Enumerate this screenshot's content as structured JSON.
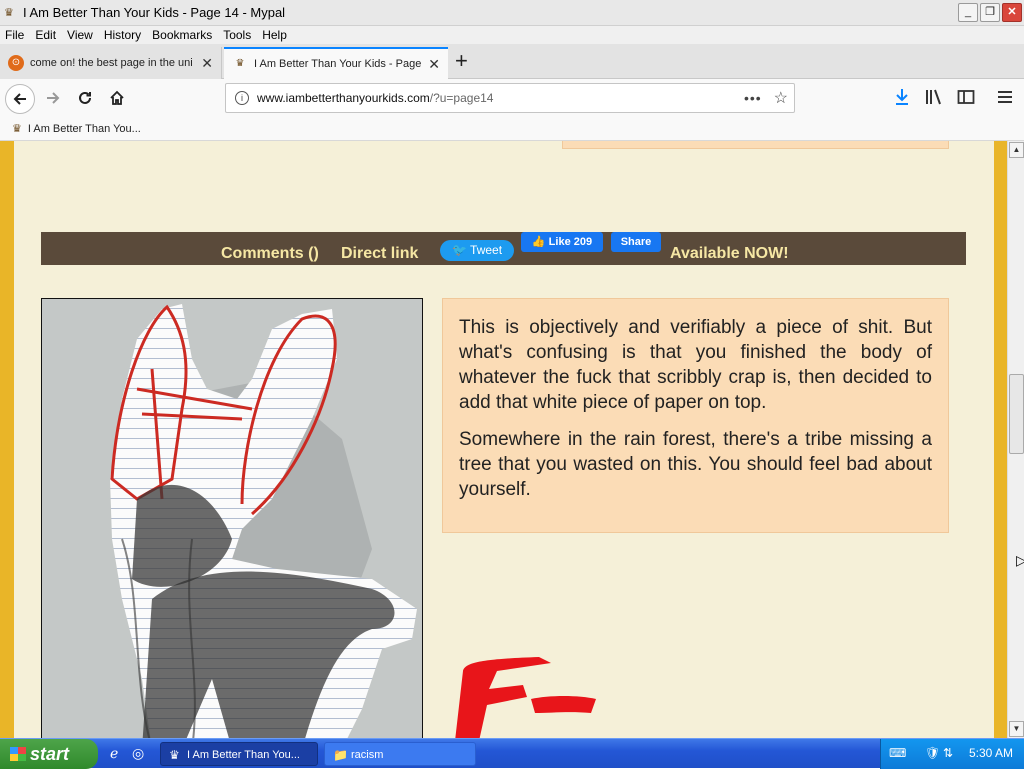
{
  "window": {
    "title": "I Am Better Than Your Kids - Page 14 - Mypal",
    "controls": {
      "minimize": "_",
      "restore": "❐",
      "close": "✕"
    }
  },
  "menu": [
    "File",
    "Edit",
    "View",
    "History",
    "Bookmarks",
    "Tools",
    "Help"
  ],
  "tabs": [
    {
      "label": "come on! the best page in the uni",
      "icon": "globe-icon",
      "active": false
    },
    {
      "label": "I Am Better Than Your Kids - Page",
      "icon": "crown-icon",
      "active": true
    }
  ],
  "newtab": "+",
  "nav": {
    "url_domain": "www.iambetterthanyourkids.com",
    "url_path": "/?u=page14",
    "more": "•••"
  },
  "bookmarks": [
    {
      "label": "I Am Better Than You..."
    }
  ],
  "page": {
    "bar": {
      "comments": "Comments ()",
      "direct_link": "Direct link",
      "tweet": "Tweet",
      "like": "Like 209",
      "share": "Share",
      "available": "Available NOW!"
    },
    "critique": [
      "This is objectively and verifiably a piece of shit. But what's confusing is that you finished the body of whatever the fuck that scribbly crap is, then decided to add that white piece of paper on top.",
      "Somewhere in the rain forest, there's a tribe missing a tree that you wasted on this. You should feel bad about yourself."
    ],
    "grade": "F-"
  },
  "taskbar": {
    "start": "start",
    "tasks": [
      {
        "label": "I Am Better Than You...",
        "active": true
      },
      {
        "label": "racism",
        "active": false
      }
    ],
    "clock": "5:30 AM"
  },
  "colors": {
    "accent": "#0a84ff",
    "page_border": "#e9b528",
    "page_bg": "#f5f0d8",
    "comment_bar": "#5a4a3a",
    "link_text": "#f6e7a4",
    "critique_bg": "#fbdcb6",
    "grade_red": "#e8151a"
  }
}
